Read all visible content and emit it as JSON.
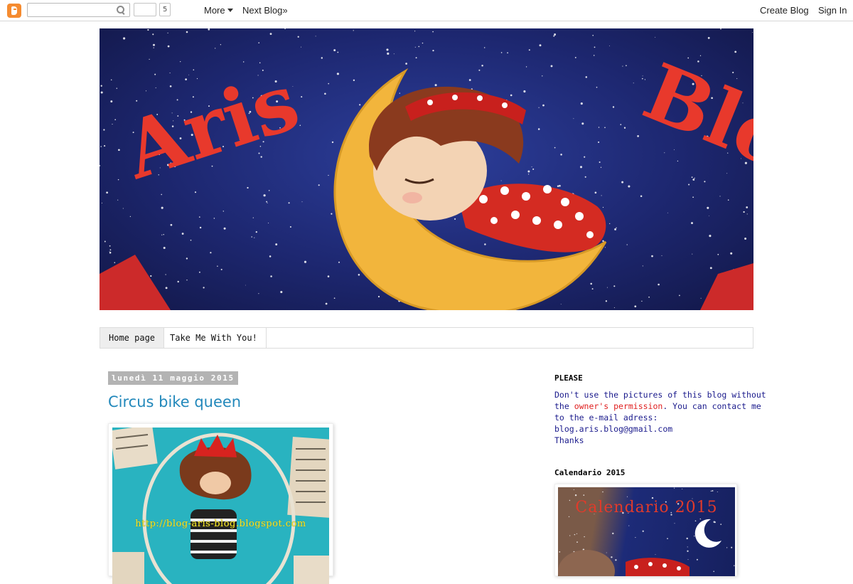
{
  "navbar": {
    "search_placeholder": "",
    "g1_count": "5",
    "more_label": "More",
    "next_blog_label": "Next Blog»",
    "create_blog_label": "Create Blog",
    "sign_in_label": "Sign In"
  },
  "header": {
    "title_left": "Aris",
    "title_right": "Blog"
  },
  "tabs": [
    {
      "label": "Home page",
      "active": true
    },
    {
      "label": "Take Me With You!",
      "active": false
    }
  ],
  "post": {
    "date": "lunedì 11 maggio 2015",
    "title": "Circus bike queen",
    "image_watermark": "http://blog-aris-blog.blogspot.com",
    "image_colors": {
      "background": "#29b3c0",
      "crown": "#d8231f"
    }
  },
  "sidebar": {
    "please_title": "PLEASE",
    "please_lines": [
      "Don't use the pictures of this blog without",
      "the ",
      "owner's permission",
      ". You can contact me",
      "to the e-mail adress:",
      "blog.aris.blog@gmail.com",
      "Thanks"
    ],
    "calendar_title": "Calendario 2015",
    "calendar_image_text": "Calendario 2015"
  },
  "colors": {
    "link_blue": "#2288bb",
    "sidebar_text": "#1a1a8c",
    "sidebar_highlight": "#e02020",
    "date_bg": "#b3b3b3",
    "blogger_orange": "#f58b30",
    "banner_title_red": "#e8392c"
  },
  "icons": {
    "blogger_logo": "blogger-logo-icon",
    "search": "search-icon",
    "more_caret": "chevron-down-icon"
  }
}
